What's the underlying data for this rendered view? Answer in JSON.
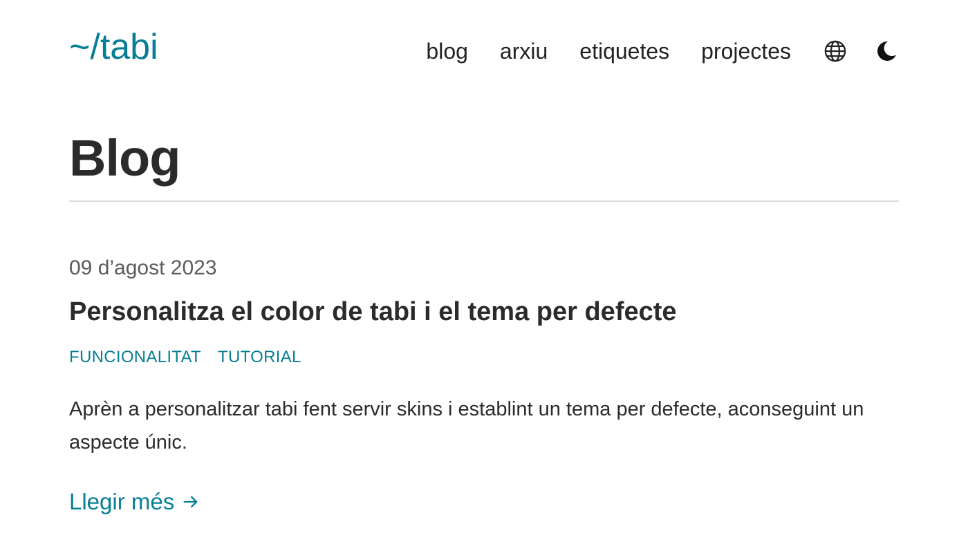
{
  "header": {
    "logo": "~/tabi",
    "nav": {
      "blog": "blog",
      "archive": "arxiu",
      "tags": "etiquetes",
      "projects": "projectes"
    },
    "icons": {
      "language": "globe-icon",
      "theme_toggle": "moon-icon"
    }
  },
  "page": {
    "title": "Blog"
  },
  "posts": [
    {
      "date": "09 d’agost 2023",
      "title": "Personalitza el color de tabi i el tema per defecte",
      "tags": [
        "FUNCIONALITAT",
        "TUTORIAL"
      ],
      "summary": "Aprèn a personalitzar tabi fent servir skins i establint un tema per defecte, aconseguint un aspecte únic.",
      "read_more": "Llegir més",
      "read_more_icon": "arrow-right-icon"
    }
  ],
  "colors": {
    "accent": "#087e96",
    "text": "#222226",
    "muted": "#5b5b60",
    "divider": "#dcdcdc",
    "background": "#ffffff"
  }
}
